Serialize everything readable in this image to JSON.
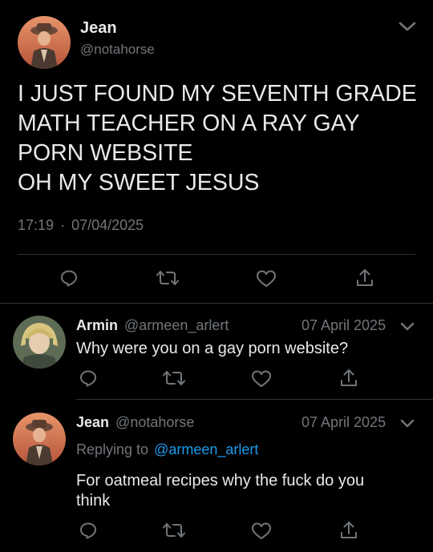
{
  "main_tweet": {
    "author_name": "Jean",
    "author_handle": "@notahorse",
    "text_lines": [
      "I JUST FOUND MY SEVENTH GRADE",
      "MATH TEACHER ON A RAY GAY",
      "PORN WEBSITE",
      "OH MY SWEET JESUS"
    ],
    "time": "17:19",
    "separator": "·",
    "date": "07/04/2025"
  },
  "replies": [
    {
      "author_name": "Armin",
      "author_handle": "@armeen_arlert",
      "date": "07 April 2025",
      "text": "Why were you on a gay porn website?"
    },
    {
      "author_name": "Jean",
      "author_handle": "@notahorse",
      "date": "07 April 2025",
      "replying_prefix": "Replying to",
      "replying_handle": "@armeen_arlert",
      "text_lines": [
        "For oatmeal recipes why the fuck do you",
        "think"
      ]
    }
  ],
  "icons": {
    "reply": "reply-icon",
    "retweet": "retweet-icon",
    "like": "heart-icon",
    "share": "share-icon",
    "more": "chevron-down-icon"
  },
  "colors": {
    "background": "#000000",
    "text": "#e7e9ea",
    "muted": "#71767b",
    "link": "#1d9bf0",
    "divider": "#2f3336"
  }
}
